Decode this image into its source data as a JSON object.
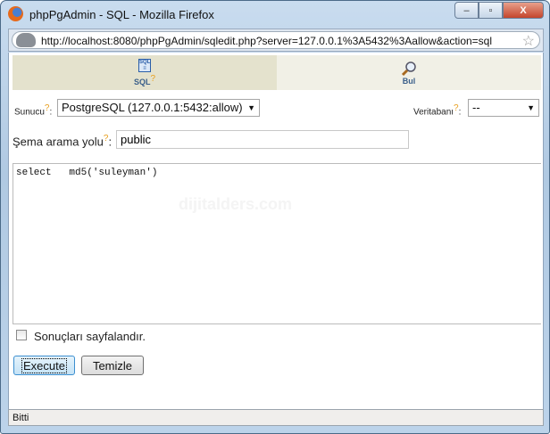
{
  "window": {
    "title": "phpPgAdmin - SQL - Mozilla Firefox",
    "minimize": "–",
    "maximize": "▫",
    "close": "X"
  },
  "browser": {
    "url": "http://localhost:8080/phpPgAdmin/sqledit.php?server=127.0.0.1%3A5432%3Aallow&action=sql",
    "status": "Bitti"
  },
  "tabs": [
    {
      "label": "SQL",
      "icon": "sql-icon",
      "active": true
    },
    {
      "label": "Bul",
      "icon": "magnifier-icon",
      "active": false
    }
  ],
  "help_mark": "?",
  "form": {
    "server_label": "Sunucu",
    "server_value": "PostgreSQL (127.0.0.1:5432:allow)",
    "database_label": "Veritabanı",
    "database_value": "--",
    "schema_label": "Şema arama yolu",
    "schema_value": "public",
    "query": "select   md5('suleyman')",
    "watermark": "dijitalders.com",
    "paginate_label": "Sonuçları sayfalandır.",
    "paginate_checked": false,
    "execute": "Execute",
    "clear": "Temizle"
  },
  "colors": {
    "tab_active": "#e4e2cd",
    "tab_inactive": "#f1f0e6",
    "help": "#e8a020"
  }
}
